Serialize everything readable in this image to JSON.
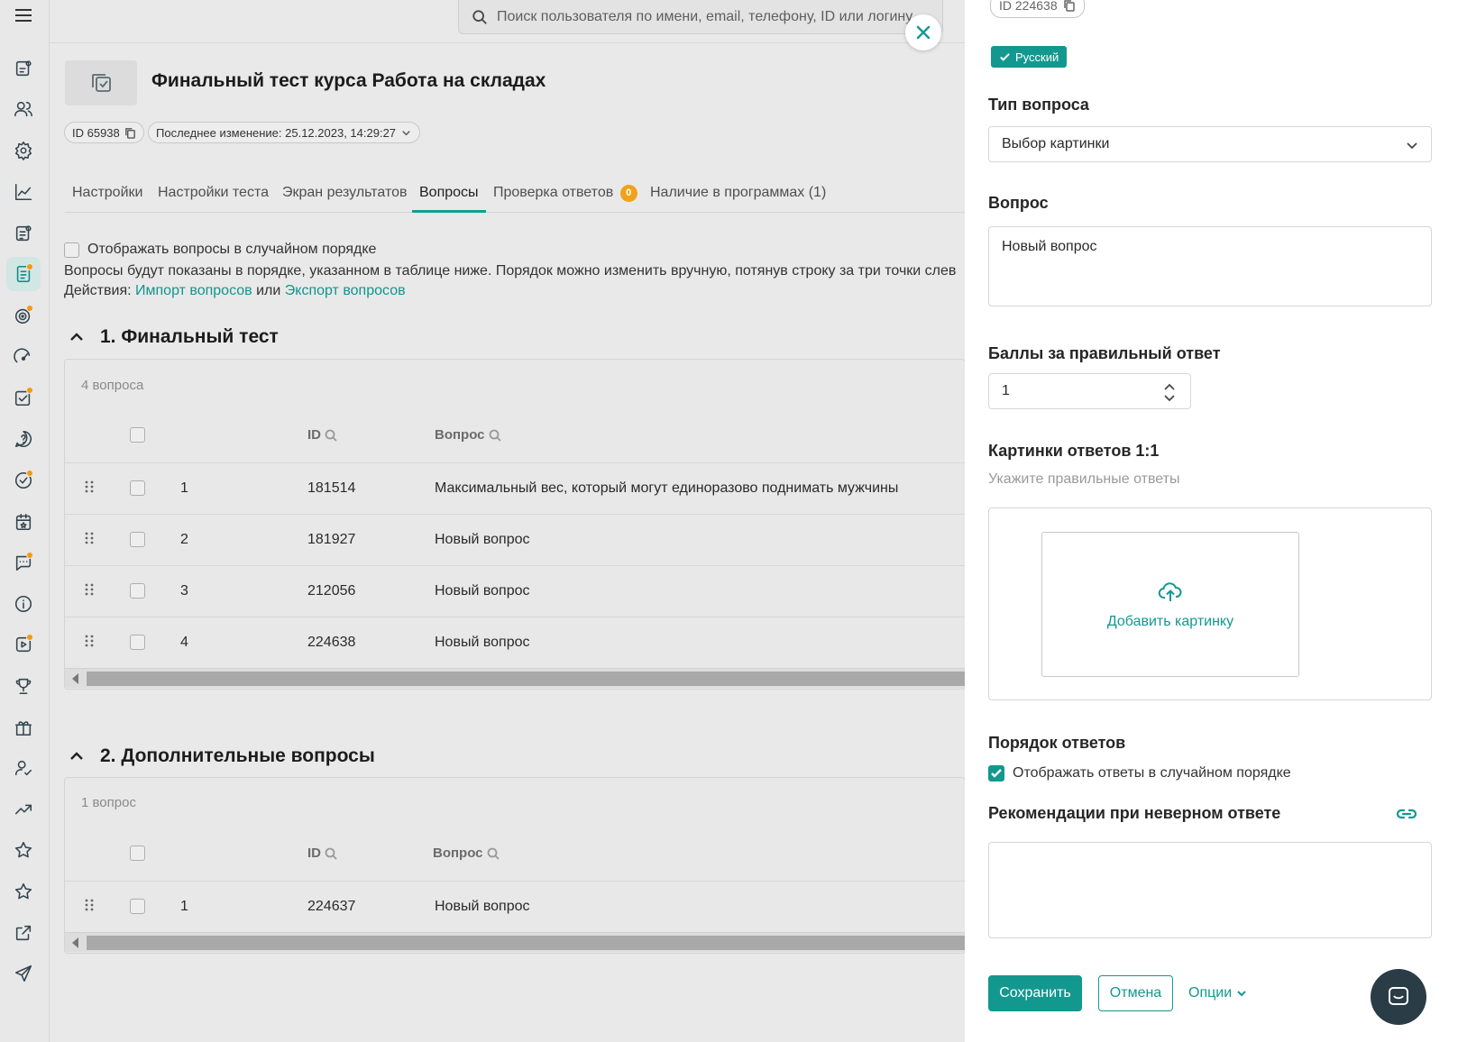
{
  "search": {
    "placeholder": "Поиск пользователя по имени, email, телефону, ID или логину"
  },
  "course": {
    "title": "Финальный тест курса Работа на складах",
    "id_chip": "ID 65938",
    "last_modified": "Последнее изменение: 25.12.2023, 14:29:27"
  },
  "tabs": [
    {
      "label": "Настройки"
    },
    {
      "label": "Настройки теста"
    },
    {
      "label": "Экран результатов"
    },
    {
      "label": "Вопросы",
      "active": true
    },
    {
      "label": "Проверка ответов",
      "badge": "0"
    },
    {
      "label": "Наличие в программах (1)"
    }
  ],
  "questions_page": {
    "random_order_label": "Отображать вопросы в случайном порядке",
    "order_info": "Вопросы будут показаны в порядке, указанном в таблице ниже. Порядок можно изменить вручную, потянув строку за три точки слев",
    "actions_prefix": "Действия:",
    "import_link": "Импорт вопросов",
    "or_word": "или",
    "export_link": "Экспорт вопросов"
  },
  "table_headers": {
    "id": "ID",
    "question": "Вопрос"
  },
  "sections": [
    {
      "title": "1. Финальный тест",
      "count": "4 вопроса",
      "rows": [
        {
          "num": "1",
          "id": "181514",
          "question": "Максимальный вес, который могут единоразово поднимать мужчины"
        },
        {
          "num": "2",
          "id": "181927",
          "question": "Новый вопрос"
        },
        {
          "num": "3",
          "id": "212056",
          "question": "Новый вопрос"
        },
        {
          "num": "4",
          "id": "224638",
          "question": "Новый вопрос"
        }
      ]
    },
    {
      "title": "2. Дополнительные вопросы",
      "count": "1 вопрос",
      "rows": [
        {
          "num": "1",
          "id": "224637",
          "question": "Новый вопрос"
        }
      ]
    }
  ],
  "drawer": {
    "id_chip": "ID 224638",
    "language": "Русский",
    "question_type_label": "Тип вопроса",
    "question_type_value": "Выбор картинки",
    "question_label": "Вопрос",
    "question_value": "Новый вопрос",
    "points_label": "Баллы за правильный ответ",
    "points_value": "1",
    "images_label": "Картинки ответов 1:1",
    "images_hint": "Укажите правильные ответы",
    "add_image": "Добавить картинку",
    "order_label": "Порядок ответов",
    "order_checkbox": "Отображать ответы в случайном порядке",
    "order_checked": true,
    "recommendations_label": "Рекомендации при неверном ответе",
    "recommendations_value": "",
    "save": "Сохранить",
    "cancel": "Отмена",
    "options": "Опции"
  },
  "sidebar_icons": [
    "courses-icon",
    "users-icon",
    "settings-gear-icon",
    "analytics-chart-icon",
    "news-icon",
    "tests-icon",
    "target-icon",
    "speedometer-icon",
    "tasks-check-icon",
    "help-question-icon",
    "check-circle-icon",
    "calendar-icon",
    "chat-icon",
    "info-icon",
    "video-icon",
    "trophy-icon",
    "gift-icon",
    "user-check-icon",
    "trend-up-icon",
    "star-outline-icon",
    "star-icon",
    "external-link-icon",
    "send-icon"
  ],
  "colors": {
    "accent": "#13988f",
    "badge": "#f0a21b",
    "sidebar_bg": "#e8e8e8"
  }
}
